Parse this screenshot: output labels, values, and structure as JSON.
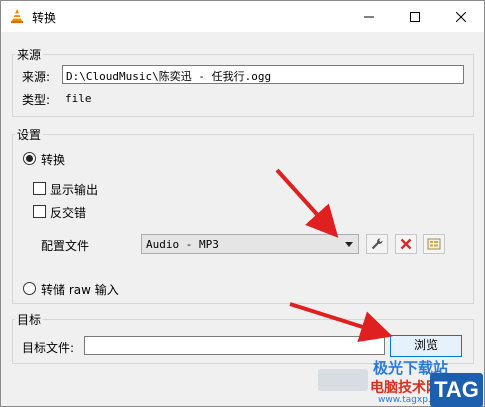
{
  "window": {
    "title": "转换",
    "controls": {
      "minimize": "minimize-icon",
      "maximize": "maximize-icon",
      "close": "close-icon"
    },
    "app_icon": "vlc-cone-icon"
  },
  "source": {
    "group_label": "来源",
    "source_label": "来源:",
    "source_value": "D:\\CloudMusic\\陈奕迅 - 任我行.ogg",
    "type_label": "类型:",
    "type_value": "file"
  },
  "settings": {
    "group_label": "设置",
    "convert_label": "转换",
    "convert_selected": true,
    "show_output_label": "显示输出",
    "show_output_checked": false,
    "deinterlace_label": "反交错",
    "deinterlace_checked": false,
    "profile_label": "配置文件",
    "profile_value": "Audio - MP3",
    "profile_tools": [
      "wrench-icon",
      "delete-x-icon",
      "new-profile-icon"
    ],
    "dump_raw_label": "转储 raw 输入",
    "dump_raw_selected": false
  },
  "destination": {
    "group_label": "目标",
    "file_label": "目标文件:",
    "file_value": "",
    "browse_label": "浏览"
  },
  "watermark": {
    "site": "极光下载站",
    "sub": "电脑技术网",
    "url": "www.tagxp.com",
    "tag": "TAG"
  },
  "colors": {
    "annotation_arrow": "#e02020",
    "delete_icon": "#d42b2b",
    "browse_border": "#0078d7"
  }
}
